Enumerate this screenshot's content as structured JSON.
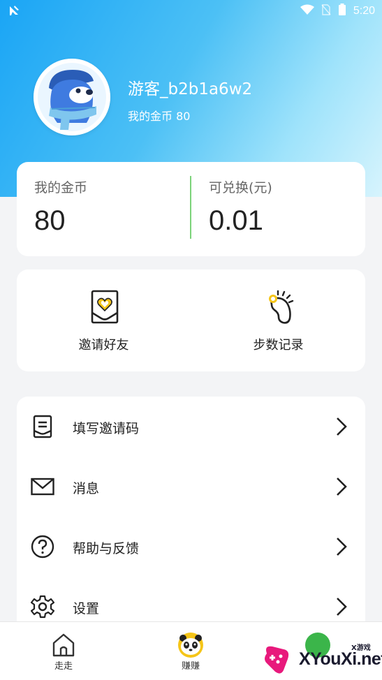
{
  "status_bar": {
    "time": "5:20",
    "icons": [
      "app-notification-icon",
      "wifi-icon",
      "no-sim-icon",
      "battery-icon"
    ]
  },
  "profile": {
    "username": "游客_b2b1a6w2",
    "coins_label": "我的金币",
    "coins_value": "80"
  },
  "coin_card": {
    "my_coins_label": "我的金币",
    "my_coins_value": "80",
    "exchange_label": "可兑换(元)",
    "exchange_value": "0.01",
    "divider_color": "#7cd37a"
  },
  "quick_actions": [
    {
      "label": "邀请好友",
      "icon": "invite-envelope-icon"
    },
    {
      "label": "步数记录",
      "icon": "footprint-icon"
    }
  ],
  "menu": [
    {
      "label": "填写邀请码",
      "icon": "document-icon"
    },
    {
      "label": "消息",
      "icon": "mail-icon"
    },
    {
      "label": "帮助与反馈",
      "icon": "help-icon"
    },
    {
      "label": "设置",
      "icon": "gear-icon"
    }
  ],
  "bottom_nav": [
    {
      "label": "走走",
      "icon": "home-icon"
    },
    {
      "label": "赚赚",
      "icon": "panda-icon"
    },
    {
      "label": "",
      "icon": "profile-icon"
    }
  ],
  "watermark": {
    "brand": "XYouXi.net",
    "small": "X游戏"
  },
  "colors": {
    "header_gradient_start": "#1aa5f5",
    "header_gradient_end": "#d7f4fd",
    "accent_yellow": "#f5c518",
    "background": "#f3f4f6"
  }
}
